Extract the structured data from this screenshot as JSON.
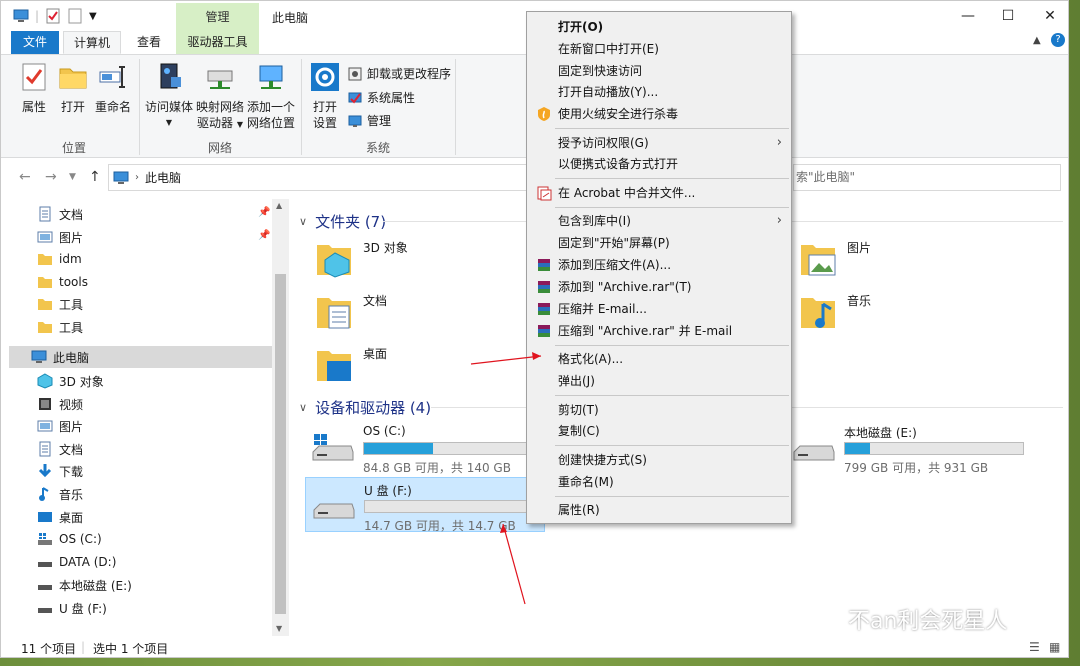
{
  "titlebar": {
    "context_tab": "管理",
    "title": "此电脑",
    "minimize": "—",
    "maximize": "☐",
    "close": "✕"
  },
  "tabs": {
    "file": "文件",
    "computer": "计算机",
    "view": "查看",
    "drive_tools": "驱动器工具"
  },
  "ribbon": {
    "location": {
      "label": "位置",
      "properties": "属性",
      "open": "打开",
      "rename": "重命名"
    },
    "network": {
      "label": "网络",
      "access_media": "访问媒体",
      "map_drive_1": "映射网络",
      "map_drive_2": "驱动器",
      "add_location_1": "添加一个",
      "add_location_2": "网络位置"
    },
    "system": {
      "label": "系统",
      "open_settings_1": "打开",
      "open_settings_2": "设置",
      "uninstall": "卸载或更改程序",
      "sys_props": "系统属性",
      "manage": "管理"
    }
  },
  "address": {
    "path": "此电脑",
    "search_placeholder": "索\"此电脑\""
  },
  "nav": {
    "items": [
      {
        "label": "文档"
      },
      {
        "label": "图片"
      },
      {
        "label": "idm"
      },
      {
        "label": "tools"
      },
      {
        "label": "工具"
      },
      {
        "label": "工具"
      },
      {
        "label": "此电脑"
      },
      {
        "label": "3D 对象"
      },
      {
        "label": "视频"
      },
      {
        "label": "图片"
      },
      {
        "label": "文档"
      },
      {
        "label": "下载"
      },
      {
        "label": "音乐"
      },
      {
        "label": "桌面"
      },
      {
        "label": "OS (C:)"
      },
      {
        "label": "DATA (D:)"
      },
      {
        "label": "本地磁盘 (E:)"
      },
      {
        "label": "U 盘 (F:)"
      }
    ]
  },
  "content": {
    "folders_title": "文件夹 (7)",
    "folders": [
      {
        "label": "3D 对象"
      },
      {
        "label": "文档"
      },
      {
        "label": "桌面"
      },
      {
        "label": "图片"
      },
      {
        "label": "音乐"
      }
    ],
    "drives_title": "设备和驱动器 (4)",
    "drives": [
      {
        "name": "OS (C:)",
        "info": "84.8 GB 可用，共 140 GB",
        "used_fraction": 0.39
      },
      {
        "name": "U 盘 (F:)",
        "info": "14.7 GB 可用，共 14.7 GB",
        "used_fraction": 0.0
      },
      {
        "name": "本地磁盘 (E:)",
        "info": "799 GB 可用，共 931 GB",
        "used_fraction": 0.14
      }
    ]
  },
  "status": {
    "count": "11 个项目",
    "selected": "选中 1 个项目"
  },
  "context_menu": {
    "items": [
      "打开(O)",
      "在新窗口中打开(E)",
      "固定到快速访问",
      "打开自动播放(Y)...",
      "使用火绒安全进行杀毒",
      "授予访问权限(G)",
      "以便携式设备方式打开",
      "在 Acrobat 中合并文件...",
      "包含到库中(I)",
      "固定到\"开始\"屏幕(P)",
      "添加到压缩文件(A)...",
      "添加到 \"Archive.rar\"(T)",
      "压缩并 E-mail...",
      "压缩到 \"Archive.rar\" 并 E-mail",
      "格式化(A)...",
      "弹出(J)",
      "剪切(T)",
      "复制(C)",
      "创建快捷方式(S)",
      "重命名(M)",
      "属性(R)"
    ]
  },
  "watermark": "不an利会死星人",
  "colors": {
    "accent": "#1979ca",
    "selection": "#cce8ff",
    "drive_fill": "#26a0da",
    "arrow": "#e0141e"
  }
}
